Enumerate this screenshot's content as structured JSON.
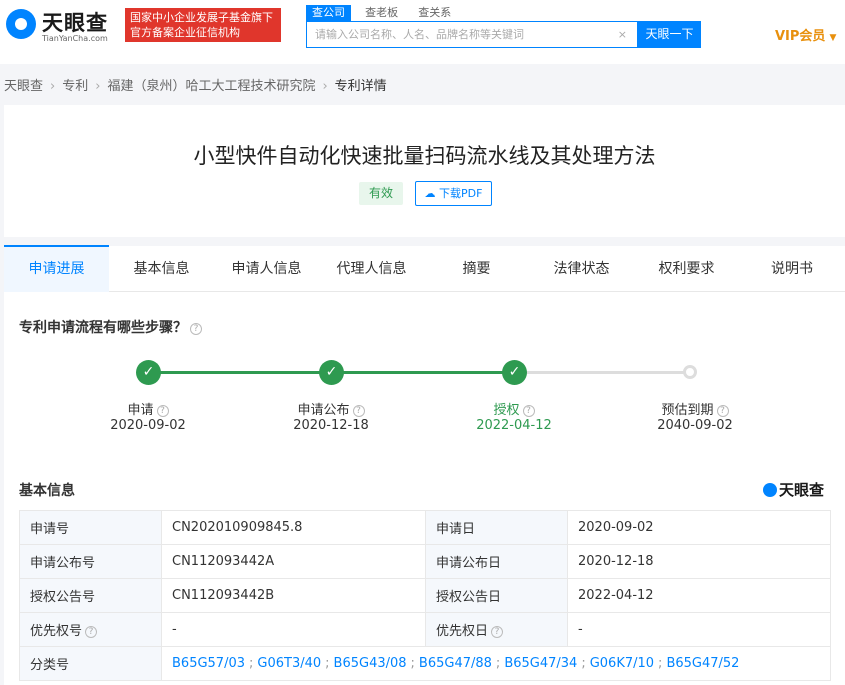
{
  "header": {
    "logo_cn": "天眼查",
    "logo_en": "TianYanCha.com",
    "banner_line1": "国家中小企业发展子基金旗下",
    "banner_line2": "官方备案企业征信机构",
    "search_tabs": [
      "查公司",
      "查老板",
      "查关系"
    ],
    "search_placeholder": "请输入公司名称、人名、品牌名称等关键词",
    "clear_icon": "×",
    "search_button": "天眼一下",
    "vip": "VIP会员"
  },
  "breadcrumb": [
    "天眼查",
    "专利",
    "福建（泉州）哈工大工程技术研究院",
    "专利详情"
  ],
  "patent": {
    "title": "小型快件自动化快速批量扫码流水线及其处理方法",
    "status": "有效",
    "pdf_button": "下载PDF"
  },
  "tabs": [
    "申请进展",
    "基本信息",
    "申请人信息",
    "代理人信息",
    "摘要",
    "法律状态",
    "权利要求",
    "说明书"
  ],
  "process": {
    "question": "专利申请流程有哪些步骤？",
    "steps": [
      {
        "label": "申请",
        "date": "2020-09-02",
        "state": "done"
      },
      {
        "label": "申请公布",
        "date": "2020-12-18",
        "state": "done"
      },
      {
        "label": "授权",
        "date": "2022-04-12",
        "state": "current"
      },
      {
        "label": "预估到期",
        "date": "2040-09-02",
        "state": "todo"
      }
    ]
  },
  "basic_info": {
    "title": "基本信息",
    "brand": "天眼查",
    "rows": [
      {
        "l1": "申请号",
        "v1": "CN202010909845.8",
        "l2": "申请日",
        "v2": "2020-09-02"
      },
      {
        "l1": "申请公布号",
        "v1": "CN112093442A",
        "l2": "申请公布日",
        "v2": "2020-12-18"
      },
      {
        "l1": "授权公告号",
        "v1": "CN112093442B",
        "l2": "授权公告日",
        "v2": "2022-04-12"
      },
      {
        "l1": "优先权号",
        "v1": "-",
        "l2": "优先权日",
        "v2": "-"
      }
    ],
    "class_label": "分类号",
    "classes": [
      "B65G57/03",
      "G06T3/40",
      "B65G43/08",
      "B65G47/88",
      "B65G47/34",
      "G06K7/10",
      "B65G47/52"
    ]
  },
  "colors": {
    "accent": "#0084ff",
    "success": "#2e9a50",
    "banner": "#e0362c",
    "vip": "#e8900d"
  }
}
